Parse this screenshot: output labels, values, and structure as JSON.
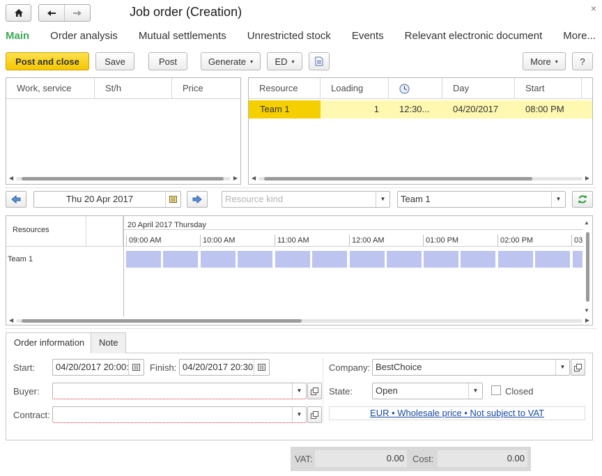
{
  "header": {
    "title": "Job order (Creation)",
    "close_glyph": "×",
    "icons": {
      "home": "home-icon",
      "back": "arrow-left-icon",
      "forward": "arrow-right-icon"
    }
  },
  "tabs": [
    {
      "label": "Main"
    },
    {
      "label": "Order analysis"
    },
    {
      "label": "Mutual settlements"
    },
    {
      "label": "Unrestricted stock"
    },
    {
      "label": "Events"
    },
    {
      "label": "Relevant electronic document"
    },
    {
      "label": "More..."
    }
  ],
  "toolbar": {
    "post_close": "Post and close",
    "save": "Save",
    "post": "Post",
    "generate": "Generate",
    "ed": "ED",
    "more": "More",
    "help": "?",
    "caret": "▾"
  },
  "works_table": {
    "columns": [
      "Work, service",
      "St/h",
      "Price"
    ]
  },
  "resource_table": {
    "columns": [
      "Resource",
      "Loading",
      "",
      "Day",
      "Start"
    ],
    "rows": [
      {
        "resource": "Team 1",
        "loading": "1",
        "time": "12:30...",
        "day": "04/20/2017",
        "start": "08:00 PM"
      }
    ]
  },
  "planner": {
    "date": "Thu 20 Apr 2017",
    "resource_kind_placeholder": "Resource kind",
    "team": "Team 1",
    "resources_header": "Resources",
    "day_label": "20 April 2017 Thursday",
    "hours": [
      "09:00 AM",
      "10:00 AM",
      "11:00 AM",
      "12:00 AM",
      "01:00 PM",
      "02:00 PM",
      "03"
    ],
    "rows": [
      {
        "name": "Team 1"
      }
    ]
  },
  "subtabs": [
    "Order information",
    "Note"
  ],
  "form": {
    "start_label": "Start:",
    "start_value": "04/20/2017 20:00:",
    "finish_label": "Finish:",
    "finish_value": "04/20/2017 20:30:",
    "buyer_label": "Buyer:",
    "buyer_value": "",
    "contract_label": "Contract:",
    "contract_value": "",
    "company_label": "Company:",
    "company_value": "BestChoice",
    "state_label": "State:",
    "state_value": "Open",
    "closed_label": "Closed",
    "closed_checked": false,
    "price_link": "EUR • Wholesale price • Not subject to VAT"
  },
  "totals": {
    "vat_label": "VAT:",
    "vat_value": "0.00",
    "cost_label": "Cost:",
    "cost_value": "0.00"
  },
  "colors": {
    "accent_green": "#3ea857",
    "primary_yellow": "#f5c600",
    "selected_row": "#fff8b0",
    "gantt_cell": "#bcc4ef",
    "link": "#1a4aa5"
  }
}
